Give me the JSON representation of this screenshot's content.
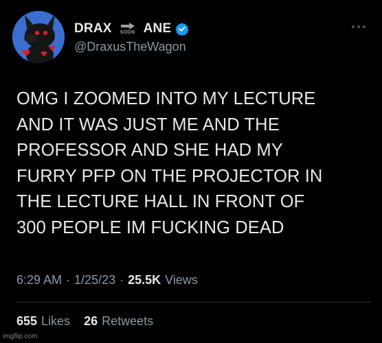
{
  "colors": {
    "background": "#000000",
    "text_primary": "#e7e9ea",
    "text_secondary": "#8b98a5",
    "verified_badge": "#1d9bf0",
    "avatar_bg": "#3a6fd1"
  },
  "author": {
    "name_left": "DRAX",
    "name_badge_text": "SOON",
    "name_right": "ANE",
    "verified_icon": "verified-badge-icon",
    "handle": "@DraxusTheWagon",
    "avatar_icon": "avatar-plush-icon"
  },
  "more_icon": "more-options-icon",
  "tweet": {
    "text": "OMG I ZOOMED INTO MY LECTURE\nAND IT WAS JUST ME AND THE\nPROFESSOR AND SHE HAD MY\nFURRY PFP ON THE PROJECTOR IN\nTHE LECTURE HALL IN FRONT OF\n300 PEOPLE IM FUCKING DEAD"
  },
  "meta": {
    "time": "6:29 AM",
    "sep1": "·",
    "date": "1/25/23",
    "sep2": "·",
    "views_count": "25.5K",
    "views_label": "Views"
  },
  "stats": {
    "likes_count": "655",
    "likes_label": "Likes",
    "retweets_count": "26",
    "retweets_label": "Retweets"
  },
  "watermark": "imgflip.com"
}
